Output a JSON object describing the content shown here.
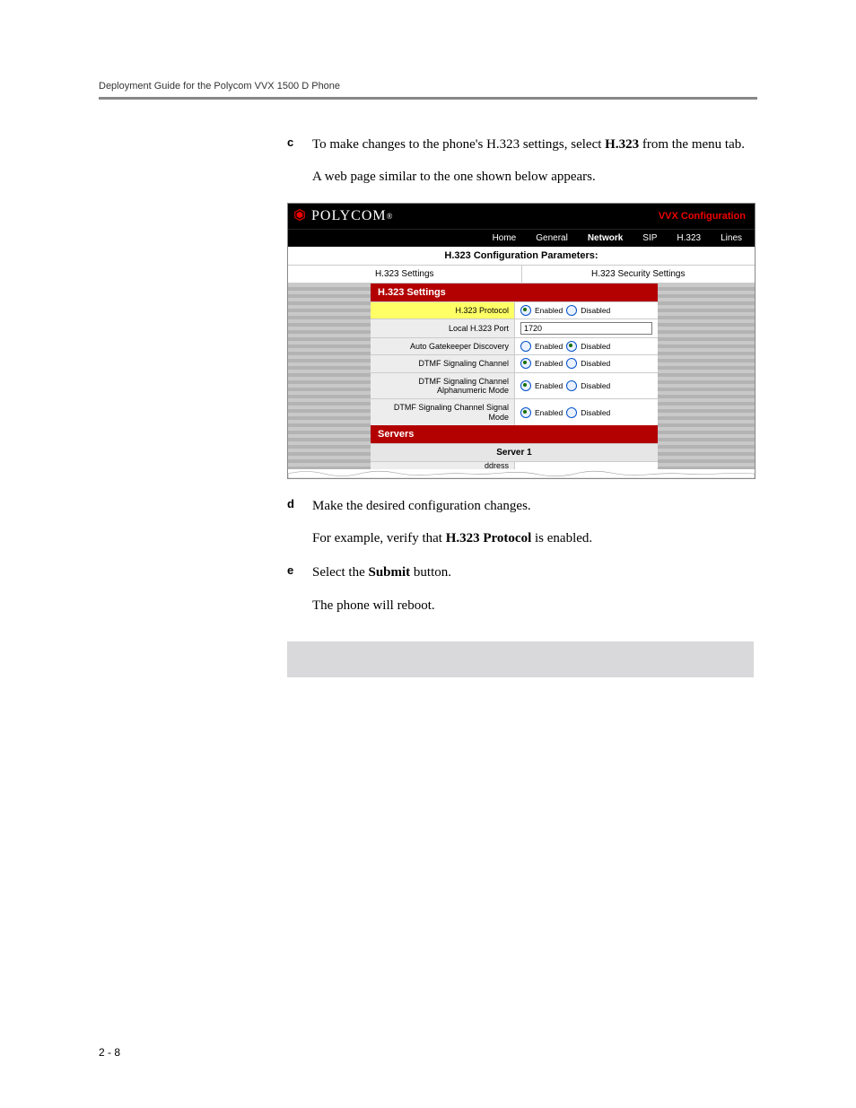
{
  "running_header": "Deployment Guide for the Polycom VVX 1500 D Phone",
  "steps": {
    "c": {
      "letter": "c",
      "line1a": "To make changes to the phone's H.323 settings, select ",
      "line1b": "H.323",
      "line1c": " from the menu tab.",
      "line2": "A web page similar to the one shown below appears."
    },
    "d": {
      "letter": "d",
      "line1": "Make the desired configuration changes.",
      "line2a": "For example, verify that ",
      "line2b": "H.323 Protocol",
      "line2c": " is enabled."
    },
    "e": {
      "letter": "e",
      "line1a": "Select the ",
      "line1b": "Submit",
      "line1c": " button.",
      "line2": "The phone will reboot."
    }
  },
  "ss": {
    "brand": "POLYCOM",
    "caption": "VVX Configuration",
    "nav": {
      "home": "Home",
      "general": "General",
      "network": "Network",
      "sip": "SIP",
      "h323": "H.323",
      "lines": "Lines"
    },
    "subhead": "H.323 Configuration Parameters:",
    "tabs": {
      "settings": "H.323 Settings",
      "security": "H.323 Security Settings"
    },
    "section_settings": "H.323 Settings",
    "rows": {
      "protocol": "H.323 Protocol",
      "port": "Local H.323 Port",
      "port_value": "1720",
      "autogk": "Auto Gatekeeper Discovery",
      "dtmf": "DTMF Signaling Channel",
      "dtmf_alpha": "DTMF Signaling Channel Alphanumeric Mode",
      "dtmf_signal": "DTMF Signaling Channel Signal Mode",
      "enabled": "Enabled",
      "disabled": "Disabled"
    },
    "section_servers": "Servers",
    "server1": "Server 1",
    "address_stub": "ddress"
  },
  "page_number": "2 - 8"
}
